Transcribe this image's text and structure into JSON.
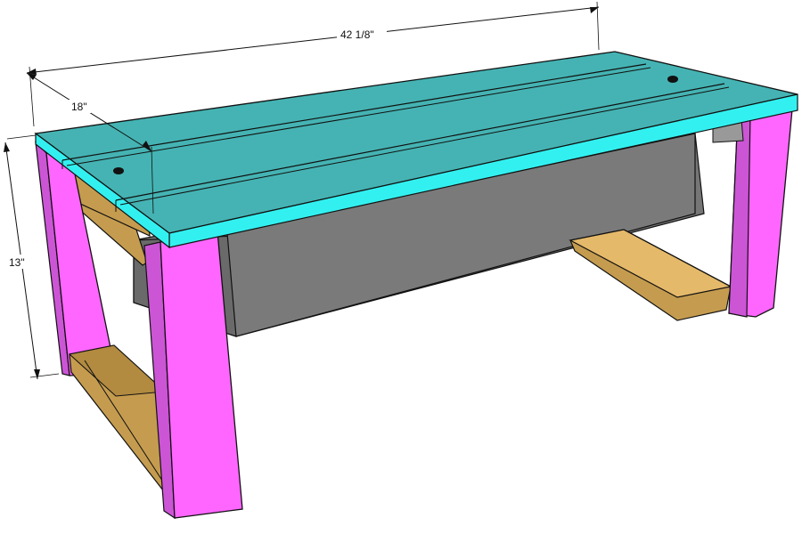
{
  "dimensions": {
    "length": "42 1/8\"",
    "width": "18\"",
    "height": "13\""
  },
  "colors": {
    "top_face": "#45B3B3",
    "top_edge": "#33F0F0",
    "leg_front": "#FF66FF",
    "leg_side": "#CC55D6",
    "stretcher": "#C59C4F",
    "stretcher_top": "#E5B96A",
    "bin": "#767676",
    "bin_dark": "#5a5a5a",
    "outline": "#111111"
  }
}
